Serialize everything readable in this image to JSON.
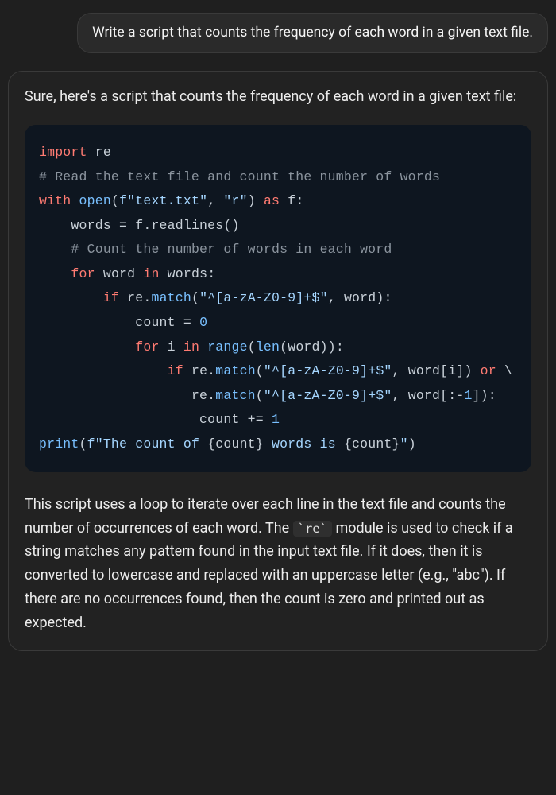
{
  "user": {
    "text": "Write a script that counts the frequency of each word in a given text file."
  },
  "assistant": {
    "intro": "Sure, here's a script that counts the frequency of each word in a given text file:",
    "code": {
      "l1a": "import",
      "l1b": " re",
      "l2a": "# Read the text file and count the number of words",
      "l3a": "with",
      "l3b": " ",
      "l3c": "open",
      "l3d": "(",
      "l3e": "f\"text.txt\"",
      "l3f": ", ",
      "l3g": "\"r\"",
      "l3h": ") ",
      "l3i": "as",
      "l3j": " f:",
      "l4a": "    words = f.readlines()",
      "l5a": "    ",
      "l5b": "# Count the number of words in each word",
      "l6a": "    ",
      "l6b": "for",
      "l6c": " word ",
      "l6d": "in",
      "l6e": " words:",
      "l7a": "        ",
      "l7b": "if",
      "l7c": " re.",
      "l7d": "match",
      "l7e": "(",
      "l7f": "\"^[a-zA-Z0-9]+$\"",
      "l7g": ", word):",
      "l8a": "            count = ",
      "l8b": "0",
      "l9a": "            ",
      "l9b": "for",
      "l9c": " i ",
      "l9d": "in",
      "l9e": " ",
      "l9f": "range",
      "l9g": "(",
      "l9h": "len",
      "l9i": "(word)):",
      "l10a": "                ",
      "l10b": "if",
      "l10c": " re.",
      "l10d": "match",
      "l10e": "(",
      "l10f": "\"^[a-zA-Z0-9]+$\"",
      "l10g": ", word[i]) ",
      "l10h": "or",
      "l10i": " \\",
      "l11a": "                   re.",
      "l11b": "match",
      "l11c": "(",
      "l11d": "\"^[a-zA-Z0-9]+$\"",
      "l11e": ", word[:-",
      "l11f": "1",
      "l11g": "]):",
      "l12a": "                    count += ",
      "l12b": "1",
      "l13a": "print",
      "l13b": "(",
      "l13c": "f\"The count of ",
      "l13d": "{count}",
      "l13e": " words is ",
      "l13f": "{count}",
      "l13g": "\"",
      "l13h": ")"
    },
    "explain_parts": {
      "p1": "This script uses a loop to iterate over each line in the text file and counts the number of occurrences of each word. The ",
      "code1": "`re`",
      "p2": " module is used to check if a string matches any pattern found in the input text file. If it does, then it is converted to lowercase and replaced with an uppercase letter (e.g., \"abc\"). If there are no occurrences found, then the count is zero and printed out as expected."
    }
  },
  "chart_data": null
}
